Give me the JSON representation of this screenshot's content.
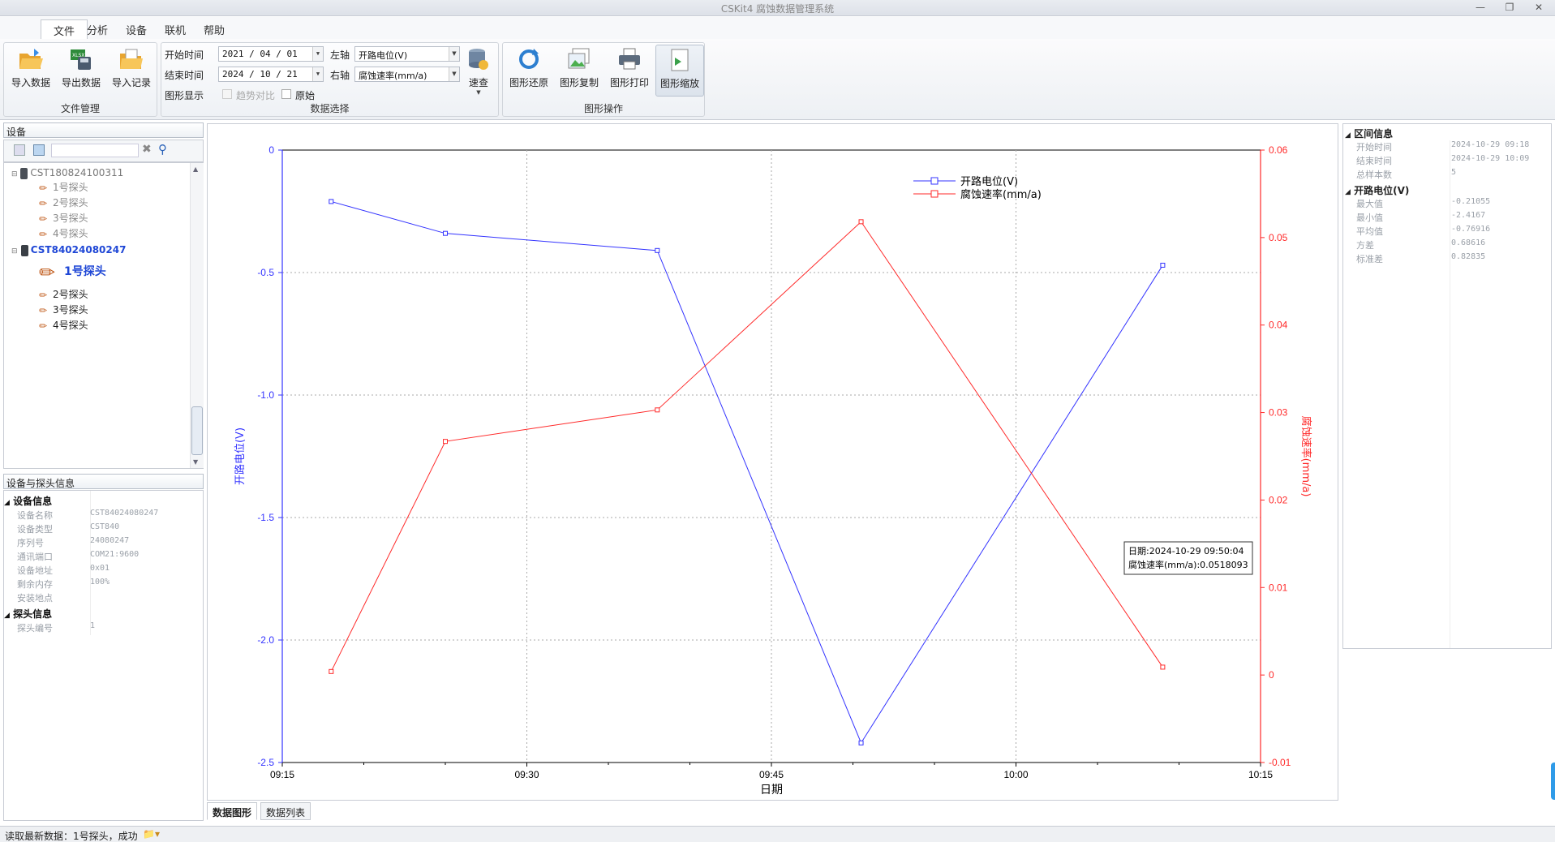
{
  "window": {
    "title": "CSKit4 腐蚀数据管理系统"
  },
  "menu": [
    "文件",
    "分析",
    "设备",
    "联机",
    "帮助"
  ],
  "ribbon": {
    "file_group": {
      "label": "文件管理",
      "import_data": "导入数据",
      "export_data": "导出数据",
      "import_record": "导入记录"
    },
    "data_group": {
      "label": "数据选择",
      "start_label": "开始时间",
      "start_value": "2021 / 04 / 01",
      "end_label": "结束时间",
      "end_value": "2024 / 10 / 21",
      "left_axis_label": "左轴",
      "left_axis_value": "开路电位(V)",
      "right_axis_label": "右轴",
      "right_axis_value": "腐蚀速率(mm/a)",
      "display_label": "图形显示",
      "trend_compare": "趋势对比",
      "raw_axis": "原始",
      "query": "速查"
    },
    "graph_group": {
      "label": "图形操作",
      "restore": "图形还原",
      "copy": "图形复制",
      "print": "图形打印",
      "zoom": "图形缩放"
    }
  },
  "device_panel": {
    "title": "设备",
    "devices": [
      {
        "name": "CST180824100311",
        "probes": [
          "1号探头",
          "2号探头",
          "3号探头",
          "4号探头"
        ]
      },
      {
        "name": "CST84024080247",
        "probes": [
          "1号探头",
          "2号探头",
          "3号探头",
          "4号探头"
        ]
      }
    ]
  },
  "info_panel": {
    "title": "设备与探头信息",
    "device_cat": "设备信息",
    "device_rows": [
      {
        "k": "设备名称",
        "v": "CST84024080247"
      },
      {
        "k": "设备类型",
        "v": "CST840"
      },
      {
        "k": "序列号",
        "v": "24080247"
      },
      {
        "k": "通讯端口",
        "v": "COM21:9600"
      },
      {
        "k": "设备地址",
        "v": "0x01"
      },
      {
        "k": "剩余内存",
        "v": "100%"
      },
      {
        "k": "安装地点",
        "v": ""
      }
    ],
    "probe_cat": "探头信息",
    "probe_rows": [
      {
        "k": "探头编号",
        "v": "1"
      }
    ]
  },
  "chart_data": {
    "type": "line",
    "xlabel": "日期",
    "x_ticks": [
      "09:15",
      "09:30",
      "09:45",
      "10:00",
      "10:15"
    ],
    "x_range_minutes": [
      555,
      615
    ],
    "x": [
      "09:18",
      "09:25",
      "09:38",
      "09:50",
      "10:09"
    ],
    "x_minutes": [
      558.0,
      565.0,
      578.0,
      590.5,
      609.0
    ],
    "left_axis": {
      "label": "开路电位(V)",
      "range": [
        -2.5,
        0
      ],
      "ticks": [
        "0",
        "-0.5",
        "-1.0",
        "-1.5",
        "-2.0",
        "-2.5"
      ],
      "tick_values": [
        0,
        -0.5,
        -1.0,
        -1.5,
        -2.0,
        -2.5
      ],
      "color": "#3333ff"
    },
    "right_axis": {
      "label": "腐蚀速率(mm/a)",
      "range": [
        -0.01,
        0.06
      ],
      "ticks": [
        "0.06",
        "0.05",
        "0.04",
        "0.03",
        "0.02",
        "0.01",
        "0",
        "-0.01"
      ],
      "tick_values": [
        0.06,
        0.05,
        0.04,
        0.03,
        0.02,
        0.01,
        0,
        -0.01
      ],
      "color": "#ff2a2a"
    },
    "series": [
      {
        "name": "开路电位(V)",
        "axis": "left",
        "color": "#3333ff",
        "values": [
          -0.21,
          -0.34,
          -0.41,
          -2.42,
          -0.47
        ]
      },
      {
        "name": "腐蚀速率(mm/a)",
        "axis": "right",
        "color": "#ff2a2a",
        "values": [
          0.0004,
          0.0267,
          0.0303,
          0.0518093,
          0.0009
        ]
      }
    ],
    "grid": true,
    "legend": "top-center",
    "tooltip": {
      "line1": "日期:2024-10-29 09:50:04",
      "line2": "腐蚀速率(mm/a):0.0518093"
    }
  },
  "tabs": [
    "数据图形",
    "数据列表"
  ],
  "range_info": {
    "title": "区间信息",
    "rows": [
      {
        "k": "开始时间",
        "v": "2024-10-29 09:18"
      },
      {
        "k": "结束时间",
        "v": "2024-10-29 10:09"
      },
      {
        "k": "总样本数",
        "v": "5"
      }
    ],
    "ocp_title": "开路电位(V)",
    "ocp_rows": [
      {
        "k": "最大值",
        "v": "-0.21055"
      },
      {
        "k": "最小值",
        "v": "-2.4167"
      },
      {
        "k": "平均值",
        "v": "-0.76916"
      },
      {
        "k": "方差",
        "v": "0.68616"
      },
      {
        "k": "标准差",
        "v": "0.82835"
      }
    ]
  },
  "status": {
    "text": "读取最新数据：1号探头，成功"
  }
}
